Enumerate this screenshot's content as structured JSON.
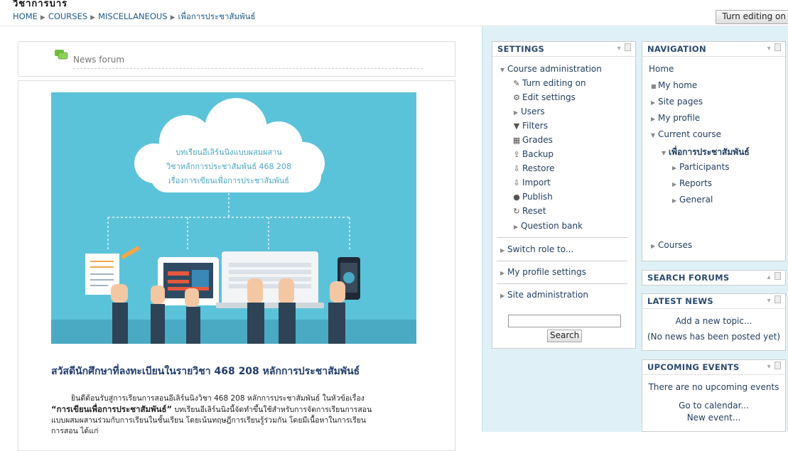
{
  "breadcrumb": {
    "items": [
      "HOME",
      "COURSES",
      "MISCELLANEOUS",
      "เพื่อการประชาสัมพันธ์"
    ]
  },
  "header": {
    "turn_editing_button": "Turn editing on",
    "top_strip_text": "วิชาการบาร"
  },
  "news_forum": {
    "label": "News forum"
  },
  "banner": {
    "lines": [
      "บทเรียนอีเลิร์นนิงแบบผสมผสาน",
      "วิชาหลักการประชาสัมพันธ์ 468 208",
      "เรื่องการเขียนเพื่อการประชาสัมพันธ์"
    ]
  },
  "welcome": {
    "title": "สวัสดีนักศึกษาที่ลงทะเบียนในรายวิชา 468 208 หลักการประชาสัมพันธ์",
    "line1": "ยินดีต้อนรับสู่การเรียนการสอนอีเลิร์นนิงวิชา 468 208  หลักการประชาสัมพันธ์ ในหัวข้อเรื่อง",
    "line2_bold": "“การเขียนเพื่อการประชาสัมพันธ์”",
    "line2_rest": " บทเรียนอีเลิร์นนิงนี้จัดทำขึ้นใช้สำหรับการจัดการเรียนการสอน",
    "line3": "แบบผสมผสานร่วมกับการเรียนในชั้นเรียน โดยเน้นทฤษฎีการเรียนรู้ร่วมกัน โดยมีเนื้อหาในการเรียน",
    "line4": "การสอน ได้แก่"
  },
  "settings": {
    "title": "SETTINGS",
    "course_admin": "Course administration",
    "items": [
      "Turn editing on",
      "Edit settings",
      "Users",
      "Filters",
      "Grades",
      "Backup",
      "Restore",
      "Import",
      "Publish",
      "Reset",
      "Question bank"
    ],
    "switch_role": "Switch role to...",
    "my_profile_settings": "My profile settings",
    "site_admin": "Site administration",
    "search_button": "Search",
    "search_value": ""
  },
  "navigation": {
    "title": "NAVIGATION",
    "home": "Home",
    "items": [
      "My home",
      "Site pages",
      "My profile",
      "Current course"
    ],
    "current_course": "เพื่อการประชาสัมพันธ์",
    "course_children": [
      "Participants",
      "Reports",
      "General"
    ],
    "courses": "Courses"
  },
  "search_forums": {
    "title": "SEARCH FORUMS"
  },
  "latest_news": {
    "title": "LATEST NEWS",
    "add_topic": "Add a new topic...",
    "empty": "(No news has been posted yet)"
  },
  "upcoming_events": {
    "title": "UPCOMING EVENTS",
    "empty": "There are no upcoming events",
    "calendar_link": "Go to calendar...",
    "new_event": "New event..."
  },
  "colors": {
    "link": "#1d5b8a",
    "block_heading": "#2a4a6f",
    "banner_bg": "#5bc3d9",
    "right_column_bg": "#dff1f6",
    "welcome_title": "#233c6e"
  }
}
